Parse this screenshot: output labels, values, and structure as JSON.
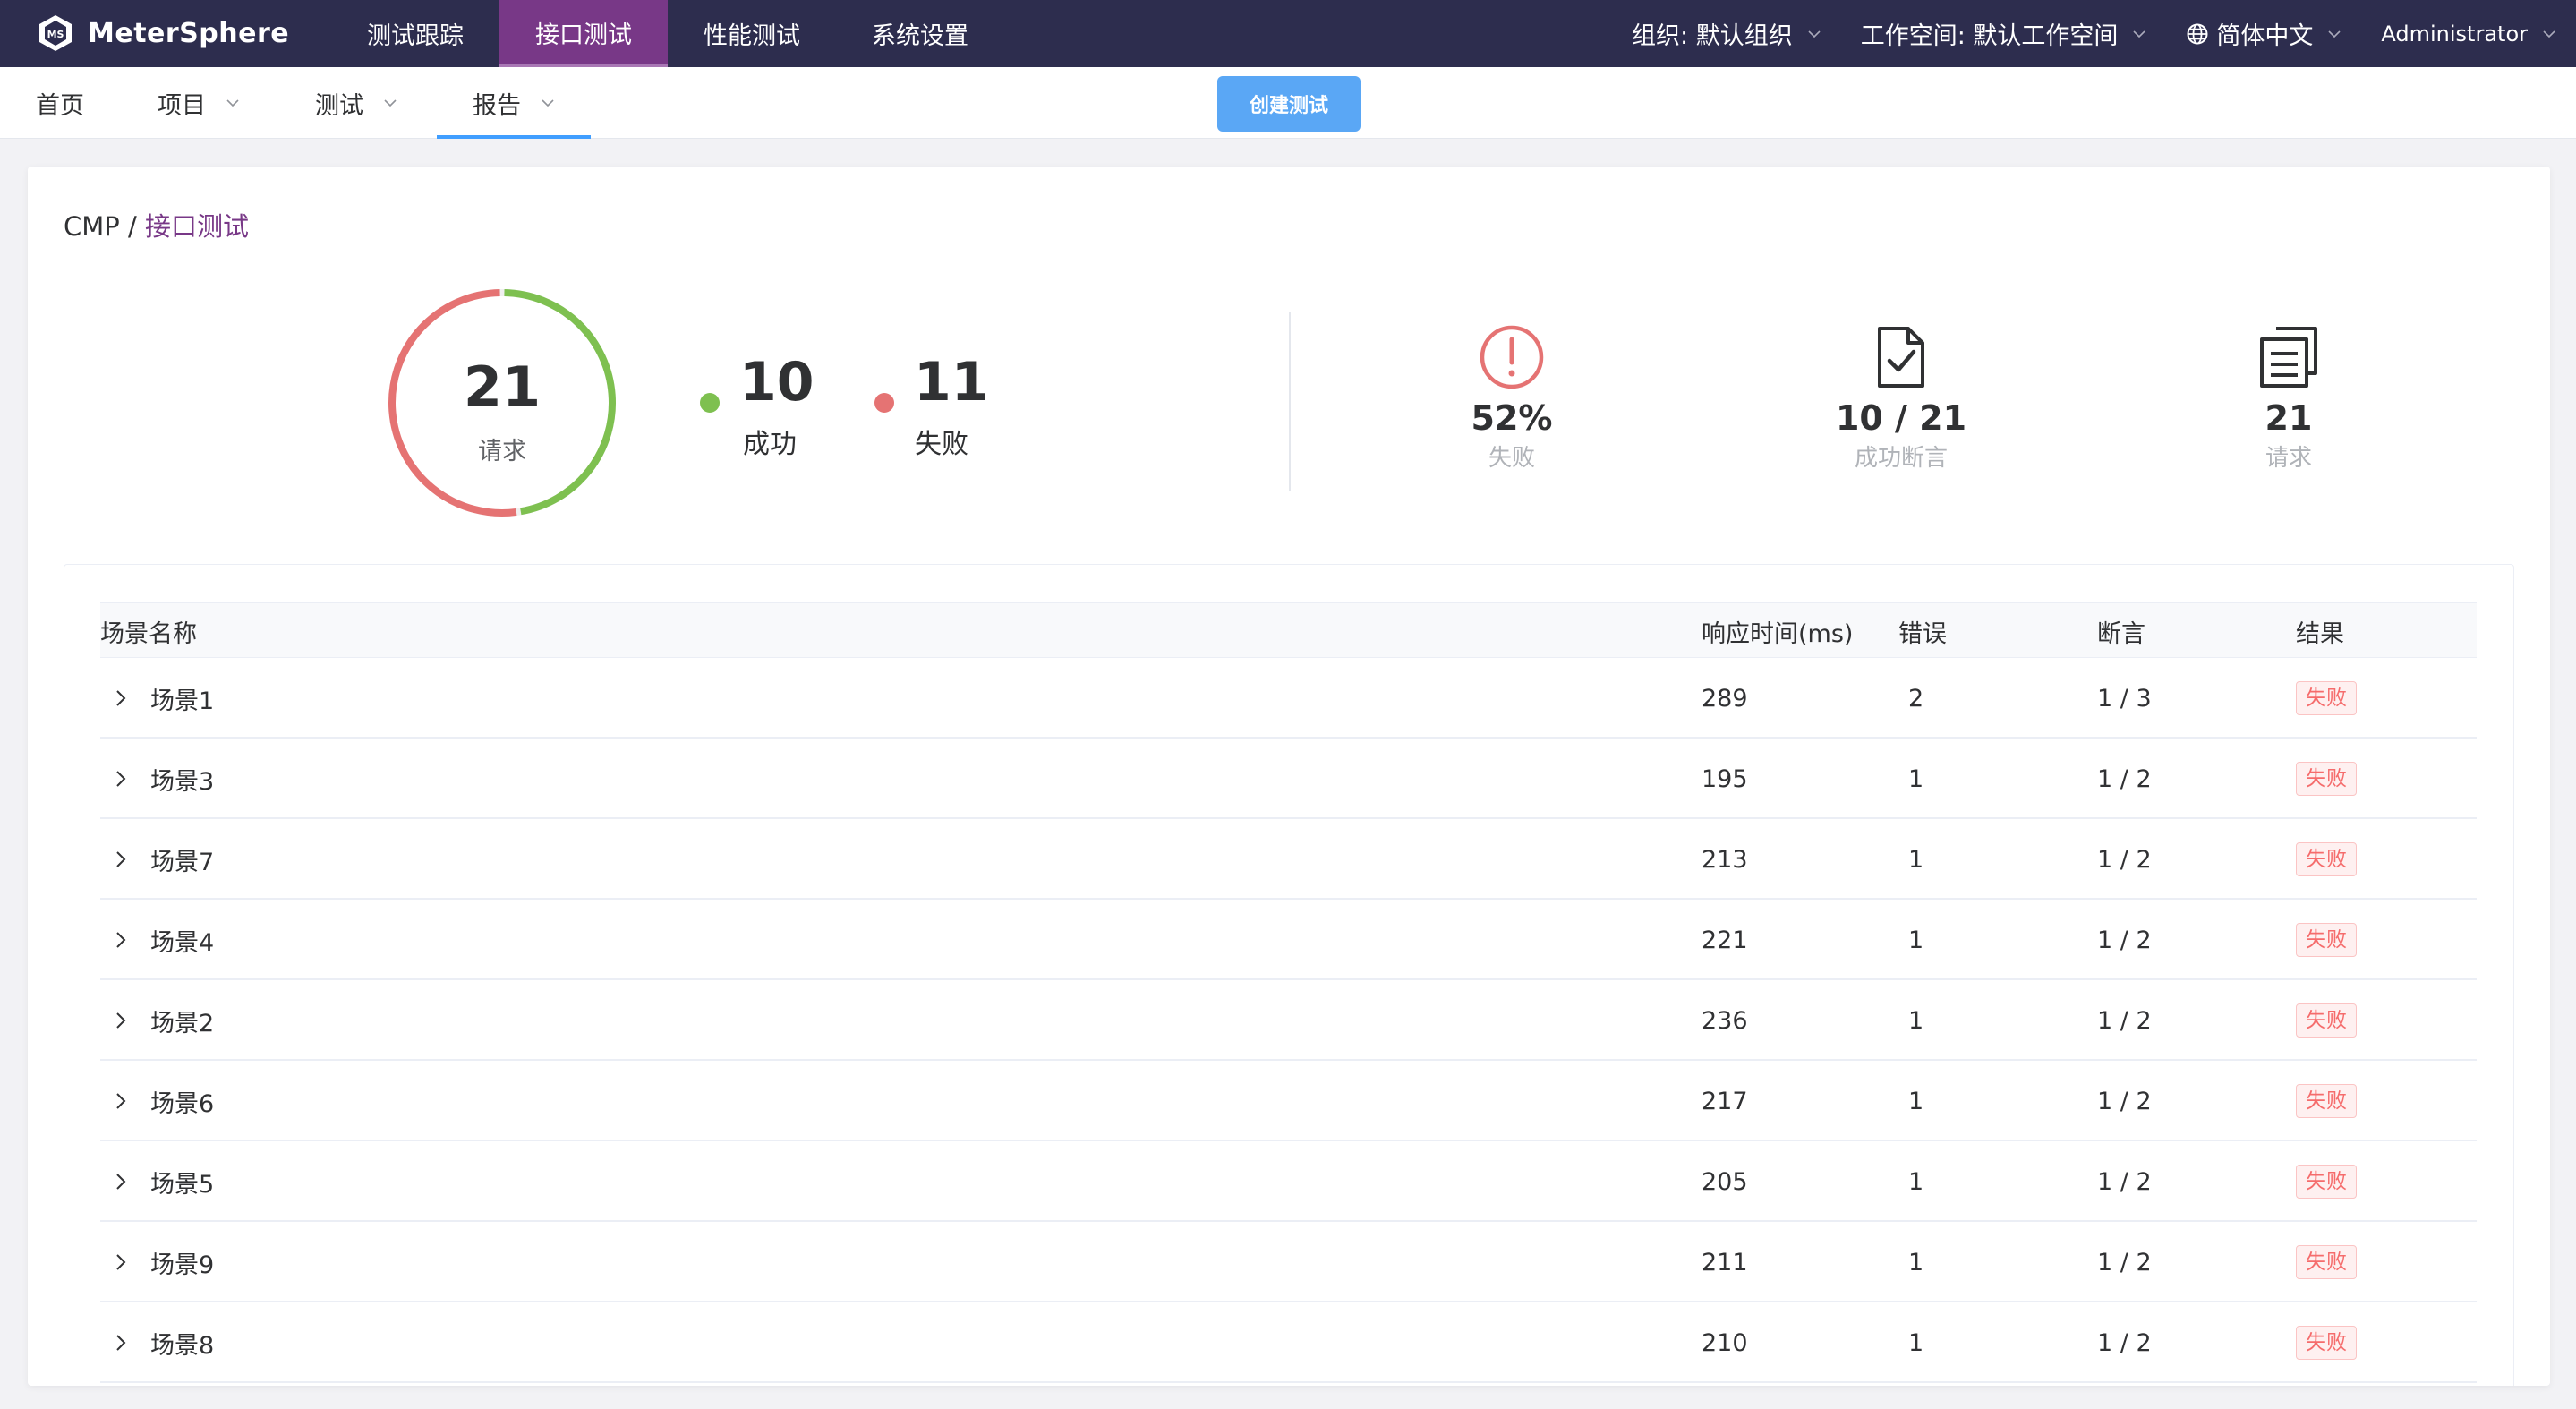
{
  "app": {
    "brand": "MeterSphere",
    "top_nav": [
      {
        "label": "测试跟踪",
        "active": false
      },
      {
        "label": "接口测试",
        "active": true
      },
      {
        "label": "性能测试",
        "active": false
      },
      {
        "label": "系统设置",
        "active": false
      }
    ],
    "org": "组织: 默认组织",
    "workspace": "工作空间: 默认工作空间",
    "language": "简体中文",
    "user": "Administrator"
  },
  "sub_nav": {
    "items": [
      {
        "label": "首页",
        "has_caret": false,
        "active": false
      },
      {
        "label": "项目",
        "has_caret": true,
        "active": false
      },
      {
        "label": "测试",
        "has_caret": true,
        "active": false
      },
      {
        "label": "报告",
        "has_caret": true,
        "active": true
      }
    ],
    "create_button": "创建测试"
  },
  "breadcrumb": {
    "root": "CMP",
    "separator": " / ",
    "current": "接口测试"
  },
  "summary": {
    "total": 21,
    "total_label": "请求",
    "success": {
      "value": 10,
      "label": "成功",
      "color": "#7ec050"
    },
    "fail": {
      "value": 11,
      "label": "失败",
      "color": "#e57373"
    },
    "metrics": [
      {
        "icon": "error-circle-icon",
        "value": "52%",
        "label": "失败"
      },
      {
        "icon": "check-file-icon",
        "value": "10 / 21",
        "label": "成功断言"
      },
      {
        "icon": "documents-icon",
        "value": "21",
        "label": "请求"
      }
    ]
  },
  "table": {
    "headers": {
      "name": "场景名称",
      "time": "响应时间(ms)",
      "errors": "错误",
      "assertions": "断言",
      "result": "结果"
    },
    "rows": [
      {
        "name": "场景1",
        "time": "289",
        "errors": "2",
        "assertions": "1 / 3",
        "result": "失败"
      },
      {
        "name": "场景3",
        "time": "195",
        "errors": "1",
        "assertions": "1 / 2",
        "result": "失败"
      },
      {
        "name": "场景7",
        "time": "213",
        "errors": "1",
        "assertions": "1 / 2",
        "result": "失败"
      },
      {
        "name": "场景4",
        "time": "221",
        "errors": "1",
        "assertions": "1 / 2",
        "result": "失败"
      },
      {
        "name": "场景2",
        "time": "236",
        "errors": "1",
        "assertions": "1 / 2",
        "result": "失败"
      },
      {
        "name": "场景6",
        "time": "217",
        "errors": "1",
        "assertions": "1 / 2",
        "result": "失败"
      },
      {
        "name": "场景5",
        "time": "205",
        "errors": "1",
        "assertions": "1 / 2",
        "result": "失败"
      },
      {
        "name": "场景9",
        "time": "211",
        "errors": "1",
        "assertions": "1 / 2",
        "result": "失败"
      },
      {
        "name": "场景8",
        "time": "210",
        "errors": "1",
        "assertions": "1 / 2",
        "result": "失败"
      }
    ]
  }
}
